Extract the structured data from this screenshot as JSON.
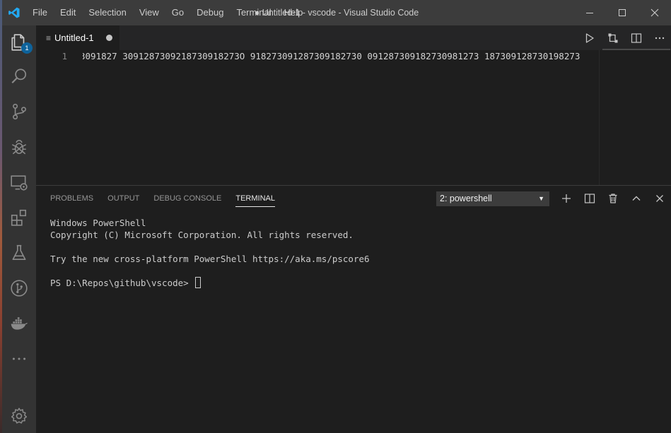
{
  "titlebar": {
    "menu": [
      "File",
      "Edit",
      "Selection",
      "View",
      "Go",
      "Debug",
      "Terminal",
      "Help"
    ],
    "window_title": "● Untitled-1 - vscode - Visual Studio Code"
  },
  "activitybar": {
    "explorer_badge": "1",
    "icons": [
      "files-icon",
      "search-icon",
      "source-control-icon",
      "debug-icon",
      "remote-explorer-icon",
      "extensions-icon",
      "testing-flask-icon",
      "git-graph-icon",
      "docker-icon",
      "more-icon",
      "settings-gear-icon"
    ]
  },
  "editor": {
    "tab_label": "Untitled-1",
    "tab_icon": "≡",
    "line_number": "1",
    "code": "3091827 3091287309218730918273O 918273091287309182730 091287309182730981273 187309128730198273",
    "code_visible": "3091827 30912873092187309182730 9182730912873091827​3 0912873091827309812​73 187309128730198273"
  },
  "panel": {
    "tabs": [
      "PROBLEMS",
      "OUTPUT",
      "DEBUG CONSOLE",
      "TERMINAL"
    ],
    "active_tab": "TERMINAL",
    "terminal_select": "2: powershell",
    "terminal_lines": [
      "Windows PowerShell",
      "Copyright (C) Microsoft Corporation. All rights reserved.",
      "",
      "Try the new cross-platform PowerShell https://aka.ms/pscore6",
      "",
      "PS D:\\Repos\\github\\vscode> "
    ]
  },
  "colors": {
    "titlebar": "#3c3c3c",
    "activitybar": "#333333",
    "editor_bg": "#1e1e1e",
    "tabs_bg": "#252526",
    "badge": "#0e639c",
    "vscode_blue": "#23a9f2"
  }
}
